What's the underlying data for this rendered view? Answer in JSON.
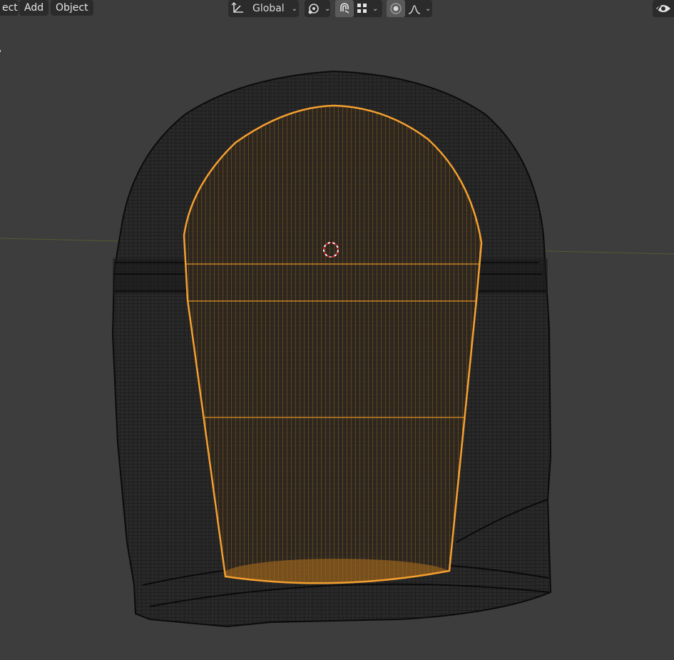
{
  "header": {
    "menu": [
      {
        "label": "ect"
      },
      {
        "label": "Add"
      },
      {
        "label": "Object"
      }
    ],
    "transform_orientation": {
      "value": "Global",
      "icon": "transform-orientation-icon"
    },
    "pivot_icon": "pivot-point-icon",
    "snap_icon": "snap-magnet-icon",
    "snap_target_icon": "snap-grid-icon",
    "proportional_icon": "proportional-editing-icon",
    "falloff_icon": "falloff-curve-icon",
    "visibility_icon": "eye-icon"
  },
  "viewport": {
    "background": "#3d3d3d",
    "selected_outline_color": "#f5a030",
    "wire_color": "#111111",
    "cursor_icon": "3d-cursor-icon"
  }
}
